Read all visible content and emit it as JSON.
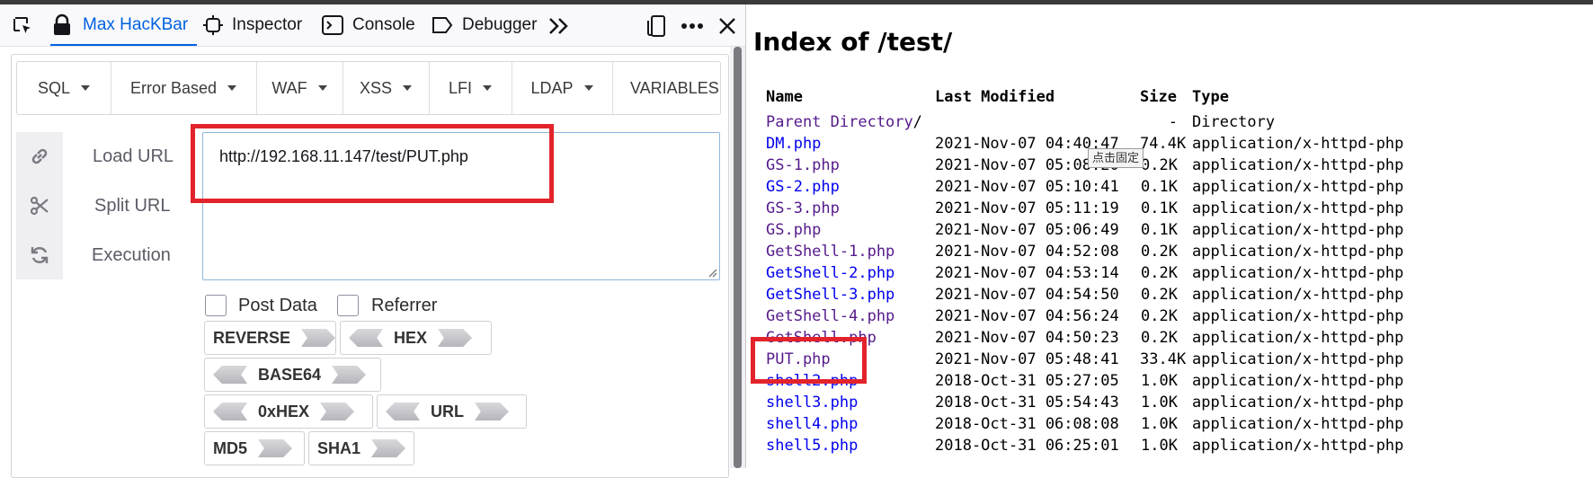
{
  "devtools": {
    "tabs": [
      {
        "label": "Max HacKBar",
        "icon": "hackbar-lock-icon",
        "active": true
      },
      {
        "label": "Inspector",
        "icon": "inspector-icon"
      },
      {
        "label": "Console",
        "icon": "console-icon"
      },
      {
        "label": "Debugger",
        "icon": "debugger-icon"
      }
    ]
  },
  "hackbar": {
    "menus": [
      "SQL",
      "Error Based",
      "WAF",
      "XSS",
      "LFI",
      "LDAP",
      "VARIABLES"
    ],
    "actions": {
      "load_url": "Load URL",
      "split_url": "Split URL",
      "execution": "Execution"
    },
    "url_value": "http://192.168.11.147/test/PUT.php",
    "options": {
      "post_data": "Post Data",
      "referrer": "Referrer"
    },
    "encoders": {
      "reverse": "REVERSE",
      "hex": "HEX",
      "base64": "BASE64",
      "oxhex": "0xHEX",
      "url": "URL",
      "md5": "MD5",
      "sha1": "SHA1"
    }
  },
  "index_page": {
    "title": "Index of /test/",
    "headers": {
      "name": "Name",
      "modified": "Last Modified",
      "size": "Size",
      "type": "Type"
    },
    "tooltip": "点击固定",
    "rows": [
      {
        "name": "Parent Directory",
        "suffix": "/",
        "modified": "",
        "size": "-",
        "type": "Directory",
        "visited": true
      },
      {
        "name": "DM.php",
        "modified": "2021-Nov-07 04:40:47",
        "size": "74.4K",
        "type": "application/x-httpd-php",
        "visited": false
      },
      {
        "name": "GS-1.php",
        "modified": "2021-Nov-07 05:08:20",
        "size": "0.2K",
        "type": "application/x-httpd-php",
        "visited": true
      },
      {
        "name": "GS-2.php",
        "modified": "2021-Nov-07 05:10:41",
        "size": "0.1K",
        "type": "application/x-httpd-php",
        "visited": false
      },
      {
        "name": "GS-3.php",
        "modified": "2021-Nov-07 05:11:19",
        "size": "0.1K",
        "type": "application/x-httpd-php",
        "visited": true
      },
      {
        "name": "GS.php",
        "modified": "2021-Nov-07 05:06:49",
        "size": "0.1K",
        "type": "application/x-httpd-php",
        "visited": true
      },
      {
        "name": "GetShell-1.php",
        "modified": "2021-Nov-07 04:52:08",
        "size": "0.2K",
        "type": "application/x-httpd-php",
        "visited": true
      },
      {
        "name": "GetShell-2.php",
        "modified": "2021-Nov-07 04:53:14",
        "size": "0.2K",
        "type": "application/x-httpd-php",
        "visited": false
      },
      {
        "name": "GetShell-3.php",
        "modified": "2021-Nov-07 04:54:50",
        "size": "0.2K",
        "type": "application/x-httpd-php",
        "visited": false
      },
      {
        "name": "GetShell-4.php",
        "modified": "2021-Nov-07 04:56:24",
        "size": "0.2K",
        "type": "application/x-httpd-php",
        "visited": true
      },
      {
        "name": "GetShell.php",
        "modified": "2021-Nov-07 04:50:23",
        "size": "0.2K",
        "type": "application/x-httpd-php",
        "visited": true
      },
      {
        "name": "PUT.php",
        "modified": "2021-Nov-07 05:48:41",
        "size": "33.4K",
        "type": "application/x-httpd-php",
        "visited": true
      },
      {
        "name": "shell2.php",
        "modified": "2018-Oct-31 05:27:05",
        "size": "1.0K",
        "type": "application/x-httpd-php",
        "visited": false
      },
      {
        "name": "shell3.php",
        "modified": "2018-Oct-31 05:54:43",
        "size": "1.0K",
        "type": "application/x-httpd-php",
        "visited": false
      },
      {
        "name": "shell4.php",
        "modified": "2018-Oct-31 06:08:08",
        "size": "1.0K",
        "type": "application/x-httpd-php",
        "visited": false
      },
      {
        "name": "shell5.php",
        "modified": "2018-Oct-31 06:25:01",
        "size": "1.0K",
        "type": "application/x-httpd-php",
        "visited": false
      }
    ]
  }
}
